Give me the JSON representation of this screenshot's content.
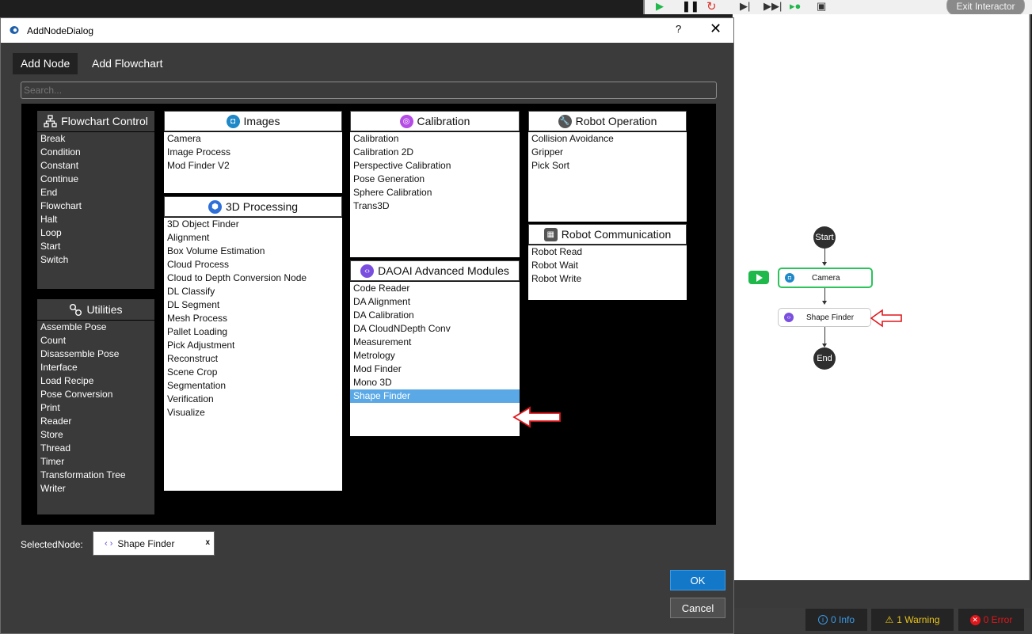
{
  "background_app": {
    "toolbar": {
      "icons": [
        "play-icon",
        "pause-icon",
        "restart-icon",
        "step-icon",
        "fast-forward-icon",
        "step-record-icon",
        "camera-robot-icon"
      ],
      "exit_label": "Exit Interactor"
    },
    "flowchart": {
      "start_label": "Start",
      "camera_label": "Camera",
      "shape_finder_label": "Shape Finder",
      "end_label": "End"
    },
    "status": {
      "info": "0 Info",
      "warning": "1 Warning",
      "error": "0 Error"
    }
  },
  "dialog": {
    "title": "AddNodeDialog",
    "help": "?",
    "close": "✕",
    "tabs": [
      "Add Node",
      "Add Flowchart"
    ],
    "search_placeholder": "Search...",
    "categories": {
      "flowchart_control": {
        "title": "Flowchart Control",
        "items": [
          "Break",
          "Condition",
          "Constant",
          "Continue",
          "End",
          "Flowchart",
          "Halt",
          "Loop",
          "Start",
          "Switch"
        ]
      },
      "utilities": {
        "title": "Utilities",
        "items": [
          "Assemble Pose",
          "Count",
          "Disassemble Pose",
          "Interface",
          "Load Recipe",
          "Pose Conversion",
          "Print",
          "Reader",
          "Store",
          "Thread",
          "Timer",
          "Transformation Tree",
          "Writer"
        ]
      },
      "images": {
        "title": "Images",
        "items": [
          "Camera",
          "Image Process",
          "Mod Finder V2"
        ]
      },
      "processing_3d": {
        "title": "3D Processing",
        "items": [
          "3D Object Finder",
          "Alignment",
          "Box Volume Estimation",
          "Cloud Process",
          "Cloud to Depth Conversion Node",
          "DL Classify",
          "DL Segment",
          "Mesh Process",
          "Pallet Loading",
          "Pick Adjustment",
          "Reconstruct",
          "Scene Crop",
          "Segmentation",
          "Verification",
          "Visualize"
        ]
      },
      "calibration": {
        "title": "Calibration",
        "items": [
          "Calibration",
          "Calibration 2D",
          "Perspective Calibration",
          "Pose Generation",
          "Sphere Calibration",
          "Trans3D"
        ]
      },
      "daoai_advanced": {
        "title": "DAOAI Advanced Modules",
        "items": [
          "Code Reader",
          "DA Alignment",
          "DA Calibration",
          "DA CloudNDepth Conv",
          "Measurement",
          "Metrology",
          "Mod Finder",
          "Mono 3D",
          "Shape Finder"
        ],
        "selected": "Shape Finder"
      },
      "robot_operation": {
        "title": "Robot Operation",
        "items": [
          "Collision Avoidance",
          "Gripper",
          "Pick Sort"
        ]
      },
      "robot_communication": {
        "title": "Robot Communication",
        "items": [
          "Robot Read",
          "Robot Wait",
          "Robot Write"
        ]
      }
    },
    "selected_node_label": "SelectedNode:",
    "selected_node_value": "Shape Finder",
    "selected_node_clear": "x",
    "ok_label": "OK",
    "cancel_label": "Cancel"
  },
  "colors": {
    "accent_blue": "#1478c8",
    "selected_row": "#5aa9e6",
    "images_icon": "#1e88c8",
    "calibration_icon": "#b54ce6",
    "processing_3d_icon": "#2f6fd8",
    "daoai_icon": "#7a4fe0",
    "robot_icon": "#555555",
    "highlight_arrow": "#e0161b",
    "camera_node_border": "#2bc45a"
  }
}
